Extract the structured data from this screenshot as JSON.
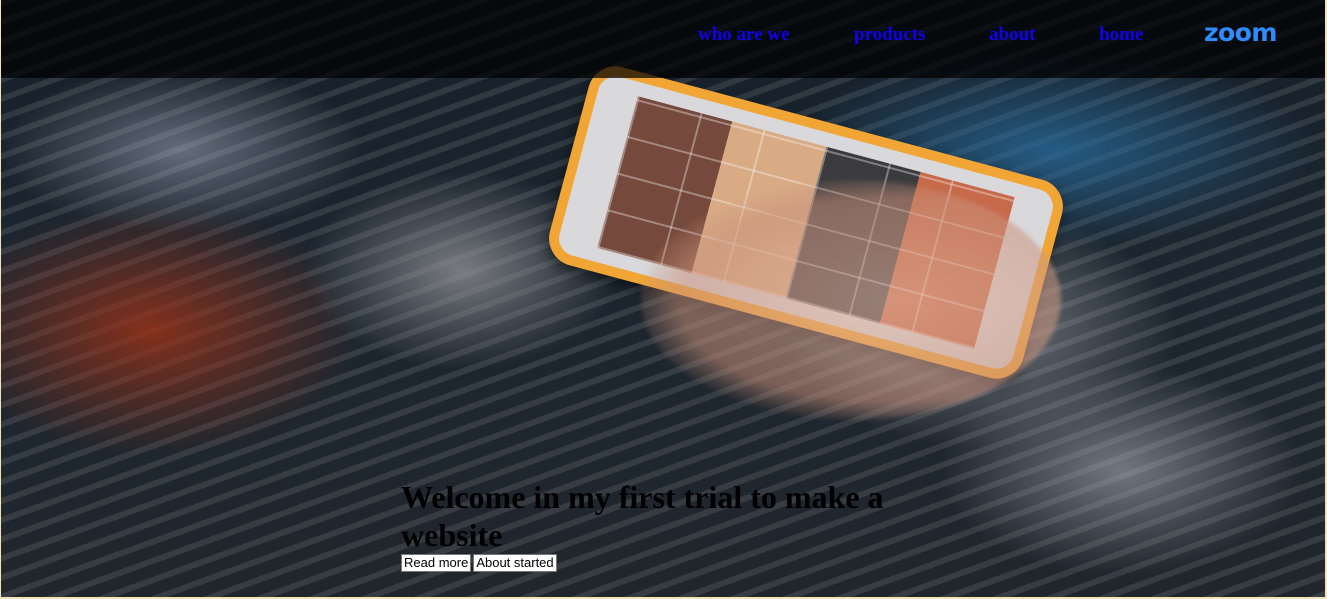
{
  "nav": {
    "logo": "zoom",
    "links": [
      "who are we",
      "products",
      "about",
      "home"
    ]
  },
  "hero": {
    "heading": "Welcome in my first trial to make a website",
    "buttons": [
      "Read more",
      "About started"
    ]
  },
  "colors": {
    "nav_link": "#1100ee",
    "logo": "#2d8cff",
    "navbar_bg": "rgba(0,0,0,0.72)",
    "page_border": "#f4e3b8"
  },
  "background_image": "woman-holding-smartphone-photo"
}
